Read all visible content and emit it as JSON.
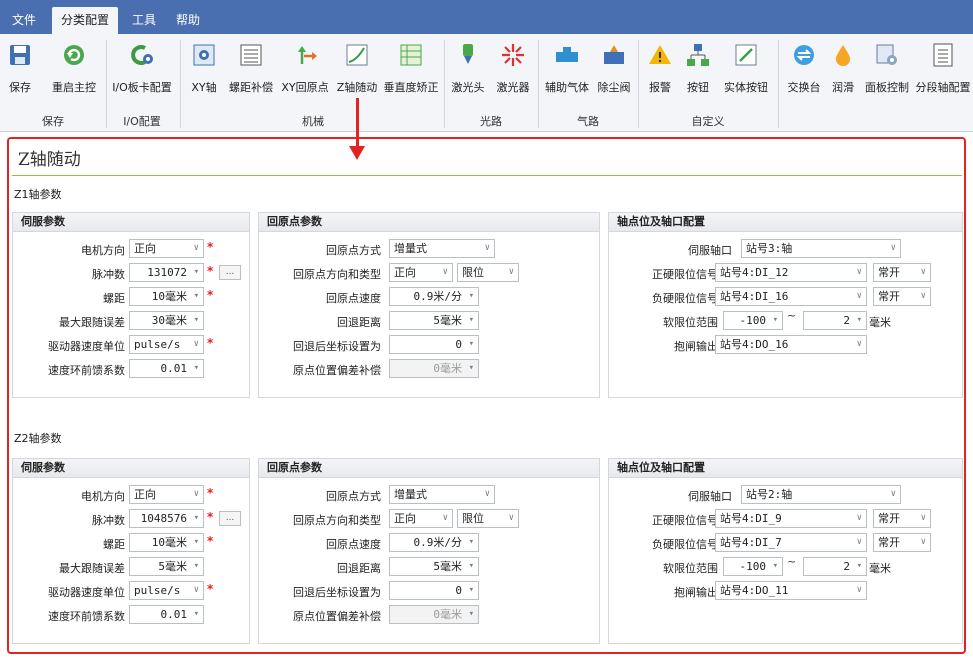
{
  "menu": {
    "tabs": [
      "文件",
      "分类配置",
      "工具",
      "帮助"
    ],
    "active_tab": "分类配置"
  },
  "ribbon": {
    "buttons": [
      "保存",
      "重启主控",
      "I/O板卡配置",
      "XY轴",
      "螺距补偿",
      "XY回原点",
      "Z轴随动",
      "垂直度矫正",
      "激光头",
      "激光器",
      "辅助气体",
      "除尘阀",
      "报警",
      "按钮",
      "实体按钮",
      "交换台",
      "润滑",
      "面板控制",
      "分段轴配置"
    ],
    "groups": [
      "保存",
      "I/O配置",
      "机械",
      "光路",
      "气路",
      "自定义"
    ]
  },
  "page": {
    "title": "Z轴随动"
  },
  "colors": {
    "menubar": "#4a6fb0",
    "highlight": "#e32222",
    "title_rule": "#8bc34a",
    "required": "#e32222"
  },
  "axes": [
    {
      "title": "Z1轴参数",
      "servo": {
        "header": "伺服参数",
        "motor_direction": {
          "label": "电机方向",
          "value": "正向"
        },
        "pulses": {
          "label": "脉冲数",
          "value": "131072",
          "button": "..."
        },
        "pitch": {
          "label": "螺距",
          "value": "10毫米"
        },
        "max_follow_error": {
          "label": "最大跟随误差",
          "value": "30毫米"
        },
        "driver_speed_unit": {
          "label": "驱动器速度单位",
          "value": "pulse/s"
        },
        "speed_loop_ff": {
          "label": "速度环前馈系数",
          "value": "0.01"
        }
      },
      "home": {
        "header": "回原点参数",
        "mode": {
          "label": "回原点方式",
          "value": "增量式"
        },
        "dir_type": {
          "label": "回原点方向和类型",
          "direction": "正向",
          "type": "限位"
        },
        "speed": {
          "label": "回原点速度",
          "value": "0.9米/分"
        },
        "retract": {
          "label": "回退距离",
          "value": "5毫米"
        },
        "after_retract_coord": {
          "label": "回退后坐标设置为",
          "value": "0"
        },
        "offset_comp": {
          "label": "原点位置偏差补偿",
          "value": "0毫米"
        }
      },
      "limits": {
        "header": "轴点位及轴口配置",
        "servo_port": {
          "label": "伺服轴口",
          "value": "站号3:轴"
        },
        "pos_hard_limit": {
          "label": "正硬限位信号",
          "value": "站号4:DI_12",
          "mode": "常开"
        },
        "neg_hard_limit": {
          "label": "负硬限位信号",
          "value": "站号4:DI_16",
          "mode": "常开"
        },
        "soft_limit": {
          "label": "软限位范围",
          "min": "-100",
          "max": "2",
          "sep": "~",
          "unit": "毫米"
        },
        "brake_output": {
          "label": "抱闸输出",
          "value": "站号4:DO_16"
        }
      }
    },
    {
      "title": "Z2轴参数",
      "servo": {
        "header": "伺服参数",
        "motor_direction": {
          "label": "电机方向",
          "value": "正向"
        },
        "pulses": {
          "label": "脉冲数",
          "value": "1048576",
          "button": "..."
        },
        "pitch": {
          "label": "螺距",
          "value": "10毫米"
        },
        "max_follow_error": {
          "label": "最大跟随误差",
          "value": "5毫米"
        },
        "driver_speed_unit": {
          "label": "驱动器速度单位",
          "value": "pulse/s"
        },
        "speed_loop_ff": {
          "label": "速度环前馈系数",
          "value": "0.01"
        }
      },
      "home": {
        "header": "回原点参数",
        "mode": {
          "label": "回原点方式",
          "value": "增量式"
        },
        "dir_type": {
          "label": "回原点方向和类型",
          "direction": "正向",
          "type": "限位"
        },
        "speed": {
          "label": "回原点速度",
          "value": "0.9米/分"
        },
        "retract": {
          "label": "回退距离",
          "value": "5毫米"
        },
        "after_retract_coord": {
          "label": "回退后坐标设置为",
          "value": "0"
        },
        "offset_comp": {
          "label": "原点位置偏差补偿",
          "value": "0毫米"
        }
      },
      "limits": {
        "header": "轴点位及轴口配置",
        "servo_port": {
          "label": "伺服轴口",
          "value": "站号2:轴"
        },
        "pos_hard_limit": {
          "label": "正硬限位信号",
          "value": "站号4:DI_9",
          "mode": "常开"
        },
        "neg_hard_limit": {
          "label": "负硬限位信号",
          "value": "站号4:DI_7",
          "mode": "常开"
        },
        "soft_limit": {
          "label": "软限位范围",
          "min": "-100",
          "max": "2",
          "sep": "~",
          "unit": "毫米"
        },
        "brake_output": {
          "label": "抱闸输出",
          "value": "站号4:DO_11"
        }
      }
    }
  ]
}
